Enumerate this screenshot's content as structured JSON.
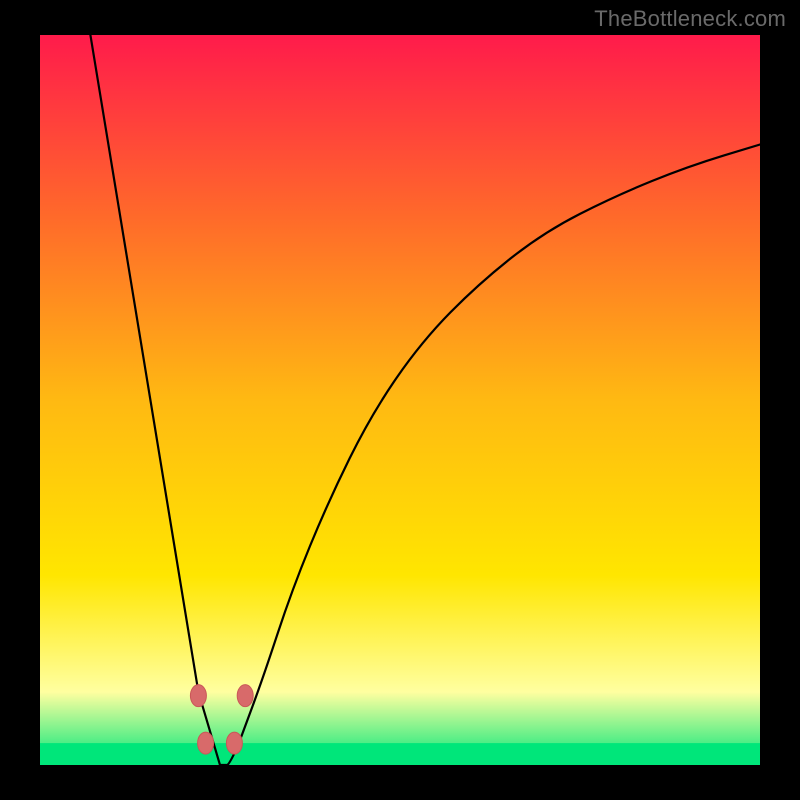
{
  "watermark": "TheBottleneck.com",
  "colors": {
    "bg": "#000000",
    "gradient_top": "#ff1b4b",
    "gradient_upper": "#ff6a2a",
    "gradient_mid": "#ffb912",
    "gradient_lower": "#ffe600",
    "gradient_pale": "#ffffa0",
    "gradient_bottom": "#00e67a",
    "curve": "#000000",
    "marker_fill": "#d86a6a",
    "marker_stroke": "#c95858"
  },
  "chart_data": {
    "type": "line",
    "title": "",
    "xlabel": "",
    "ylabel": "",
    "xlim": [
      0,
      100
    ],
    "ylim": [
      0,
      100
    ],
    "series": [
      {
        "name": "bottleneck-curve",
        "x_optimum": 25,
        "x": [
          7,
          10,
          13,
          16,
          19,
          22,
          25,
          28,
          31,
          35,
          40,
          46,
          53,
          61,
          70,
          80,
          90,
          100
        ],
        "y": [
          100,
          82,
          64,
          46,
          28,
          10,
          0,
          4,
          12,
          24,
          36,
          48,
          58,
          66,
          73,
          78,
          82,
          85
        ]
      }
    ],
    "markers": [
      {
        "x": 22.0,
        "y": 9.5
      },
      {
        "x": 23.0,
        "y": 3.0
      },
      {
        "x": 27.0,
        "y": 3.0
      },
      {
        "x": 28.5,
        "y": 9.5
      }
    ],
    "baseline_band": {
      "y0": 0,
      "y1": 3
    }
  }
}
